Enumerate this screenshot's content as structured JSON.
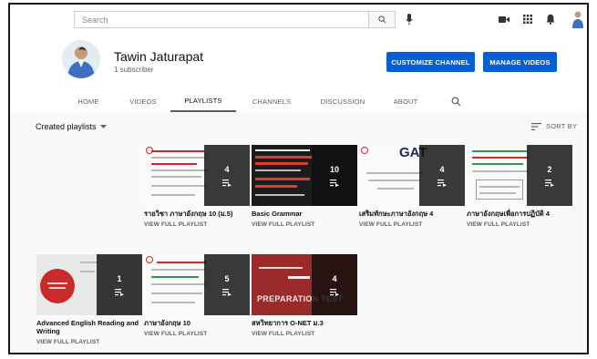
{
  "search": {
    "placeholder": "Search"
  },
  "channel": {
    "name": "Tawin Jaturapat",
    "subscribers": "1 subscriber",
    "customize_label": "CUSTOMIZE CHANNEL",
    "manage_label": "MANAGE VIDEOS"
  },
  "tabs": [
    {
      "label": "HOME",
      "active": false
    },
    {
      "label": "VIDEOS",
      "active": false
    },
    {
      "label": "PLAYLISTS",
      "active": true
    },
    {
      "label": "CHANNELS",
      "active": false
    },
    {
      "label": "DISCUSSION",
      "active": false
    },
    {
      "label": "ABOUT",
      "active": false
    }
  ],
  "section": {
    "title": "Created playlists",
    "sort_label": "SORT BY"
  },
  "playlists": [
    {
      "title": "รายวิชา ภาษาอังกฤษ 10 (ม.5)",
      "count": "4",
      "link": "VIEW FULL PLAYLIST",
      "thumb_style": "doc-red",
      "thumb_text": ""
    },
    {
      "title": "Basic Grammar",
      "count": "10",
      "link": "VIEW FULL PLAYLIST",
      "thumb_style": "dark-red",
      "thumb_text": ""
    },
    {
      "title": "เสริมทักษะภาษาอังกฤษ 4",
      "count": "4",
      "link": "VIEW FULL PLAYLIST",
      "thumb_style": "doc-title",
      "thumb_text": "GAT"
    },
    {
      "title": "ภาษาอังกฤษเพื่อการปฏิบัติ 4",
      "count": "2",
      "link": "VIEW FULL PLAYLIST",
      "thumb_style": "doc-green",
      "thumb_text": ""
    },
    {
      "title": "Advanced English Reading and Writing",
      "count": "1",
      "link": "VIEW FULL PLAYLIST",
      "thumb_style": "red-circle",
      "thumb_text": ""
    },
    {
      "title": "ภาษาอังกฤษ 10",
      "count": "5",
      "link": "VIEW FULL PLAYLIST",
      "thumb_style": "doc-red",
      "thumb_text": ""
    },
    {
      "title": "สหวิทยาการ O-NET ม.3",
      "count": "4",
      "link": "VIEW FULL PLAYLIST",
      "thumb_style": "onet",
      "thumb_text": "PREPARATION TEST"
    }
  ],
  "colors": {
    "accent": "#065fd4",
    "overlay": "#0f0f0f",
    "brand_red": "#d8262d"
  }
}
